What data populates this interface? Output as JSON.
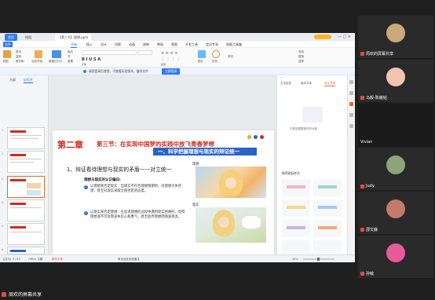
{
  "share_window": {
    "tabs": [
      "首页",
      "找相",
      "【第三节】理想.pptx"
    ],
    "active_tab_index": 2,
    "menus": [
      "文件",
      "开始",
      "插入",
      "设计",
      "切换",
      "动画",
      "放映",
      "审阅",
      "视图",
      "开发工具",
      "会员专享",
      "智能工具箱"
    ],
    "active_menu_index": 1,
    "ribbon_labels": [
      "粘贴",
      "剪切",
      "复制",
      "格式刷",
      "当前开始",
      "新建幻灯片",
      "版式",
      "节",
      "重置",
      "字体",
      "段落",
      "图片",
      "形状",
      "排列",
      "查找",
      "替换",
      "选择"
    ],
    "notice_text": "请您登录后使用，可查看历史版本，备份文件",
    "notice_button": "立即登录",
    "left_tabs": [
      "大纲",
      "幻灯片"
    ],
    "slide_numbers": [
      "1",
      "2",
      "3",
      "4",
      "5",
      "6"
    ],
    "selected_slide_index": 2,
    "slide": {
      "chapter": "第二章",
      "section": "第三节：在实现中国梦的实践中放飞青春梦想",
      "banner": "一、科学把握理想与现实的辩证统一",
      "heading": "1、辩证看待理想与现实的矛盾——对立统一",
      "subheading": "理想与现实的认识偏向:",
      "bullet1": "以理想来否定现实：当现实不符合理想预期时，对理想大失所望，甚至对现实采取全盘否定的态度。",
      "bullet2": "以现实来否定理想：在追求理想的过程中遇到现实困难时，觉得理想遥不可及而丧失信心和勇气，甚至放弃理想而随波逐流。",
      "img1_caption": "理想",
      "img2_caption": "现实"
    },
    "right_panel": {
      "tabs": [
        "文字检查",
        "版本字体",
        "设计灵感"
      ],
      "hint": "先框选需要操作的对象",
      "section_label": "推荐图标样式"
    },
    "status": {
      "left": "幻灯片 3 / 83",
      "theme": "Office 主题",
      "font_missing": "缺失字体",
      "notes": "单击此处添加备注",
      "zoom": "45%"
    }
  },
  "participants": [
    {
      "name": "周欢的屏幕共享",
      "mic_off": true,
      "color": "#f5d9a8"
    },
    {
      "name": "马毅-陈傲韬",
      "mic_off": false,
      "color": "#f2c4b0"
    },
    {
      "name": "Vivian",
      "mic_off": false,
      "color": "#1a1a1a"
    },
    {
      "name": "Judy",
      "mic_off": false,
      "color": "#8aa67a"
    },
    {
      "name": "邵文静",
      "mic_off": false,
      "color": "#c47a6a"
    },
    {
      "name": "孙敏",
      "mic_off": false,
      "color": "#e85a9a"
    }
  ],
  "bottom_label": "周欢的屏幕共享",
  "colors": {
    "accent_red": "#d02b1d",
    "banner_blue": "#2a63c4",
    "wps_blue": "#1a73e8"
  }
}
